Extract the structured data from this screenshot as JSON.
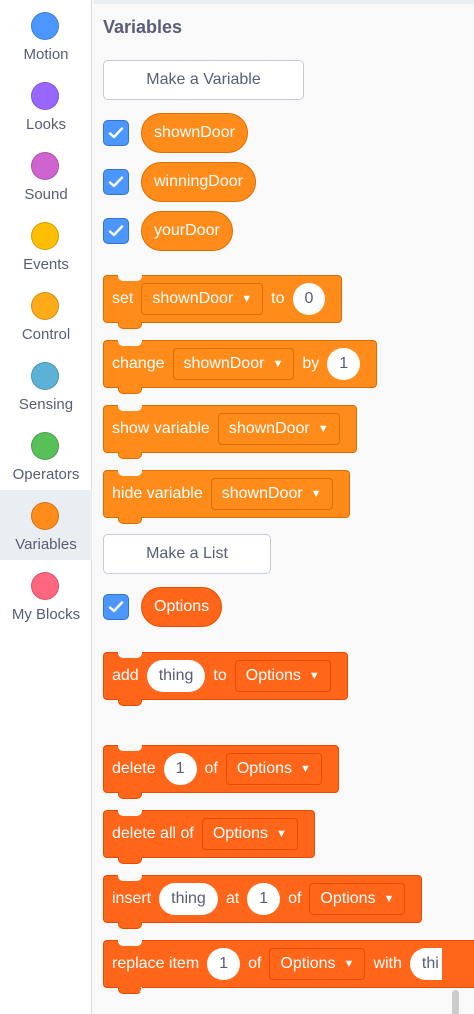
{
  "categories": [
    {
      "label": "Motion",
      "color": "#4c97ff",
      "selected": false
    },
    {
      "label": "Looks",
      "color": "#9966ff",
      "selected": false
    },
    {
      "label": "Sound",
      "color": "#cf63cf",
      "selected": false
    },
    {
      "label": "Events",
      "color": "#ffbf00",
      "selected": false
    },
    {
      "label": "Control",
      "color": "#ffab19",
      "selected": false
    },
    {
      "label": "Sensing",
      "color": "#5cb1d6",
      "selected": false
    },
    {
      "label": "Operators",
      "color": "#59c059",
      "selected": false
    },
    {
      "label": "Variables",
      "color": "#ff8c1a",
      "selected": true
    },
    {
      "label": "My Blocks",
      "color": "#ff6680",
      "selected": false
    }
  ],
  "palette": {
    "title": "Variables",
    "make_variable": "Make a Variable",
    "variables": [
      "shownDoor",
      "winningDoor",
      "yourDoor"
    ],
    "set_block": {
      "label": "set",
      "variable": "shownDoor",
      "to": "to",
      "value": "0"
    },
    "change_block": {
      "label": "change",
      "variable": "shownDoor",
      "by": "by",
      "value": "1"
    },
    "show_block": {
      "label": "show variable",
      "variable": "shownDoor"
    },
    "hide_block": {
      "label": "hide variable",
      "variable": "shownDoor"
    },
    "make_list": "Make a List",
    "list": "Options",
    "add_block": {
      "label": "add",
      "value": "thing",
      "to": "to",
      "list": "Options"
    },
    "delete_block": {
      "label": "delete",
      "value": "1",
      "of": "of",
      "list": "Options"
    },
    "delete_all_block": {
      "label": "delete all of",
      "list": "Options"
    },
    "insert_block": {
      "label": "insert",
      "value": "thing",
      "at": "at",
      "index": "1",
      "of": "of",
      "list": "Options"
    },
    "replace_block": {
      "label": "replace item",
      "index": "1",
      "of": "of",
      "list": "Options",
      "with": "with",
      "value": "thi"
    }
  },
  "colors": {
    "variables": "#ff8c1a",
    "lists": "#ff661a",
    "checkbox": "#4c97ff"
  },
  "icons": {
    "checkbox": "checkmark-icon",
    "dropdown": "dropdown-arrow-icon"
  }
}
